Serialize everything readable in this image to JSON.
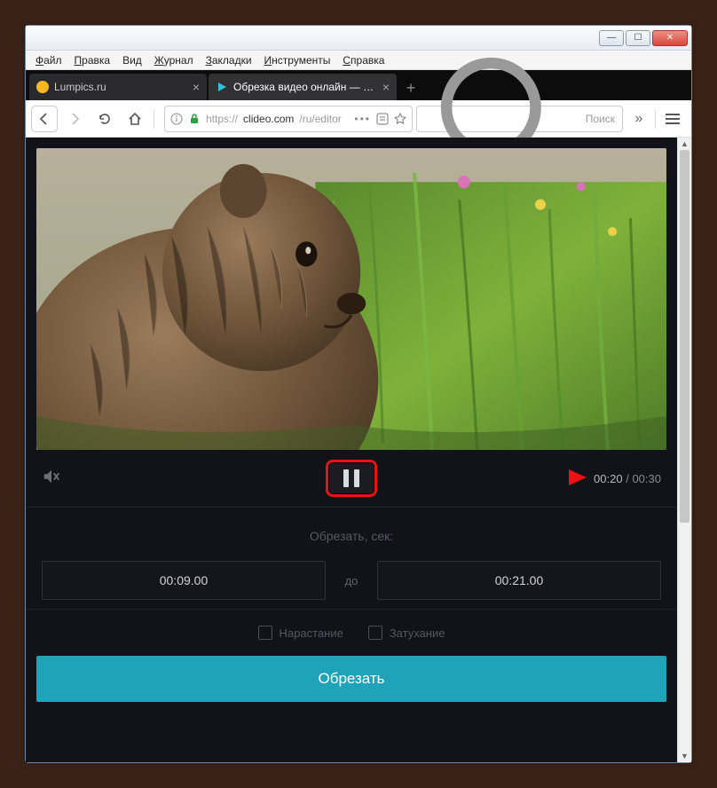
{
  "menu": {
    "file": "Файл",
    "edit": "Правка",
    "view": "Вид",
    "history": "Журнал",
    "bookmarks": "Закладки",
    "tools": "Инструменты",
    "help": "Справка"
  },
  "tabs": [
    {
      "title": "Lumpics.ru",
      "active": false
    },
    {
      "title": "Обрезка видео онлайн — Обр",
      "active": true
    }
  ],
  "url": {
    "protocol": "https://",
    "host": "clideo.com",
    "path": "/ru/editor"
  },
  "search": {
    "placeholder": "Поиск"
  },
  "player": {
    "current_time": "00:20",
    "total_time": "00:30"
  },
  "trim": {
    "title": "Обрезать, сек:",
    "from": "00:09.00",
    "to_label": "до",
    "to": "00:21.00"
  },
  "options": {
    "fade_in": "Нарастание",
    "fade_out": "Затухание"
  },
  "buttons": {
    "cut": "Обрезать"
  },
  "window_controls": {
    "min": "—",
    "max": "☐",
    "close": "✕"
  }
}
